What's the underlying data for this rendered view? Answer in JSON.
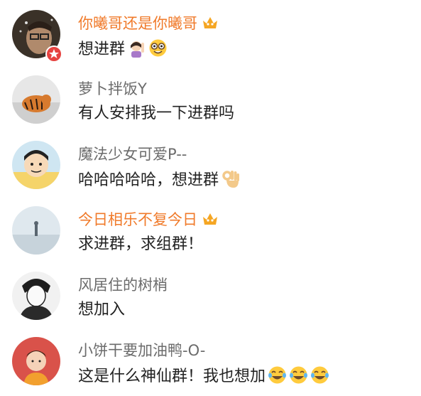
{
  "comments": [
    {
      "username": "你曦哥还是你曦哥",
      "vip": true,
      "text": "想进群",
      "emojis": [
        "woman-raising-hand-icon",
        "nerd-face-icon"
      ],
      "avatar": "man-with-glasses-avatar",
      "badge": "star-badge"
    },
    {
      "username": "萝卜拌饭Y",
      "vip": false,
      "text": "有人安排我一下进群吗",
      "emojis": [],
      "avatar": "tiger-avatar"
    },
    {
      "username": "魔法少女可爱P--",
      "vip": false,
      "text": "哈哈哈哈哈，想进群",
      "emojis": [
        "ok-hand-icon"
      ],
      "avatar": "cartoon-boy-avatar"
    },
    {
      "username": "今日相乐不复今日",
      "vip": true,
      "text": "求进群，求组群！",
      "emojis": [],
      "avatar": "beach-figure-avatar"
    },
    {
      "username": "风居住的树梢",
      "vip": false,
      "text": "想加入",
      "emojis": [],
      "avatar": "sketch-man-avatar"
    },
    {
      "username": "小饼干要加油鸭-O-",
      "vip": false,
      "text": "这是什么神仙群！我也想加",
      "emojis": [
        "crying-laughing-icon",
        "crying-laughing-icon",
        "crying-laughing-icon"
      ],
      "avatar": "child-avatar"
    }
  ],
  "colors": {
    "vip_name": "#f07a2a",
    "normal_name": "#6b6b6b",
    "text": "#222222",
    "crown": "#f5a623"
  }
}
